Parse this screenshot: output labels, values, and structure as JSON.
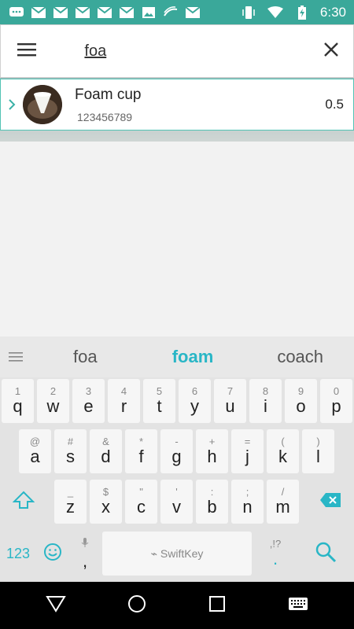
{
  "status_bar": {
    "time": "6:30",
    "left_icons": [
      "messages-icon",
      "gmail-icon",
      "gmail-icon",
      "gmail-icon",
      "gmail-icon",
      "gmail-icon",
      "image-icon",
      "swiftkey-icon",
      "gmail-icon"
    ],
    "right_icons": [
      "vibrate-icon",
      "wifi-icon",
      "battery-charging-icon"
    ]
  },
  "search": {
    "value": "foa"
  },
  "result": {
    "name": "Foam cup",
    "code": "123456789",
    "value": "0.5"
  },
  "keyboard": {
    "suggestions": [
      "foa",
      "foam",
      "coach"
    ],
    "row1": [
      {
        "h": "1",
        "k": "q"
      },
      {
        "h": "2",
        "k": "w"
      },
      {
        "h": "3",
        "k": "e"
      },
      {
        "h": "4",
        "k": "r"
      },
      {
        "h": "5",
        "k": "t"
      },
      {
        "h": "6",
        "k": "y"
      },
      {
        "h": "7",
        "k": "u"
      },
      {
        "h": "8",
        "k": "i"
      },
      {
        "h": "9",
        "k": "o"
      },
      {
        "h": "0",
        "k": "p"
      }
    ],
    "row2": [
      {
        "h": "@",
        "k": "a"
      },
      {
        "h": "#",
        "k": "s"
      },
      {
        "h": "&",
        "k": "d"
      },
      {
        "h": "*",
        "k": "f"
      },
      {
        "h": "-",
        "k": "g"
      },
      {
        "h": "+",
        "k": "h"
      },
      {
        "h": "=",
        "k": "j"
      },
      {
        "h": "(",
        "k": "k"
      },
      {
        "h": ")",
        "k": "l"
      }
    ],
    "row3": [
      {
        "h": "_",
        "k": "z"
      },
      {
        "h": "$",
        "k": "x"
      },
      {
        "h": "\"",
        "k": "c"
      },
      {
        "h": "'",
        "k": "v"
      },
      {
        "h": ":",
        "k": "b"
      },
      {
        "h": ";",
        "k": "n"
      },
      {
        "h": "/",
        "k": "m"
      }
    ],
    "numbers_label": "123",
    "comma": ",",
    "space_label": "SwiftKey",
    "period_hint": ",!?",
    "period": "."
  },
  "colors": {
    "accent": "#29b6c6",
    "status_bar": "#3aa89a",
    "selection_border": "#52c3b4"
  }
}
